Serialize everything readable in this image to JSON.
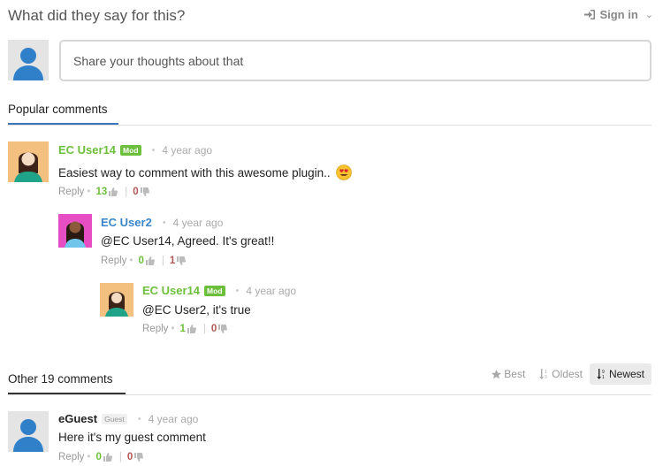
{
  "header": {
    "title": "What did they say for this?",
    "signin_label": "Sign in"
  },
  "compose": {
    "placeholder": "Share your thoughts about that"
  },
  "popular": {
    "tab_label": "Popular comments"
  },
  "comments": [
    {
      "author": "EC User14",
      "badge": "Mod",
      "time": "4 year ago",
      "text": "Easiest way to comment with this awesome plugin..",
      "reply_label": "Reply",
      "likes": "13",
      "dislikes": "0"
    },
    {
      "author": "EC User2",
      "time": "4 year ago",
      "text": "@EC User14, Agreed. It's great!!",
      "reply_label": "Reply",
      "likes": "0",
      "dislikes": "1"
    },
    {
      "author": "EC User14",
      "badge": "Mod",
      "time": "4 year ago",
      "text": "@EC User2, it's true",
      "reply_label": "Reply",
      "likes": "1",
      "dislikes": "0"
    }
  ],
  "other": {
    "tab_label": "Other 19 comments",
    "sort_options": [
      "Best",
      "Oldest",
      "Newest"
    ],
    "selected_sort": "Newest"
  },
  "guest_comment": {
    "author": "eGuest",
    "badge": "Guest",
    "time": "4 year ago",
    "text": "Here it's my guest comment",
    "reply_label": "Reply",
    "likes": "0",
    "dislikes": "0"
  },
  "colors": {
    "mod_green": "#6cbf3b",
    "link_blue": "#3a86c8",
    "tab_underline": "#3a76b8",
    "dislike_red": "#b35656"
  }
}
